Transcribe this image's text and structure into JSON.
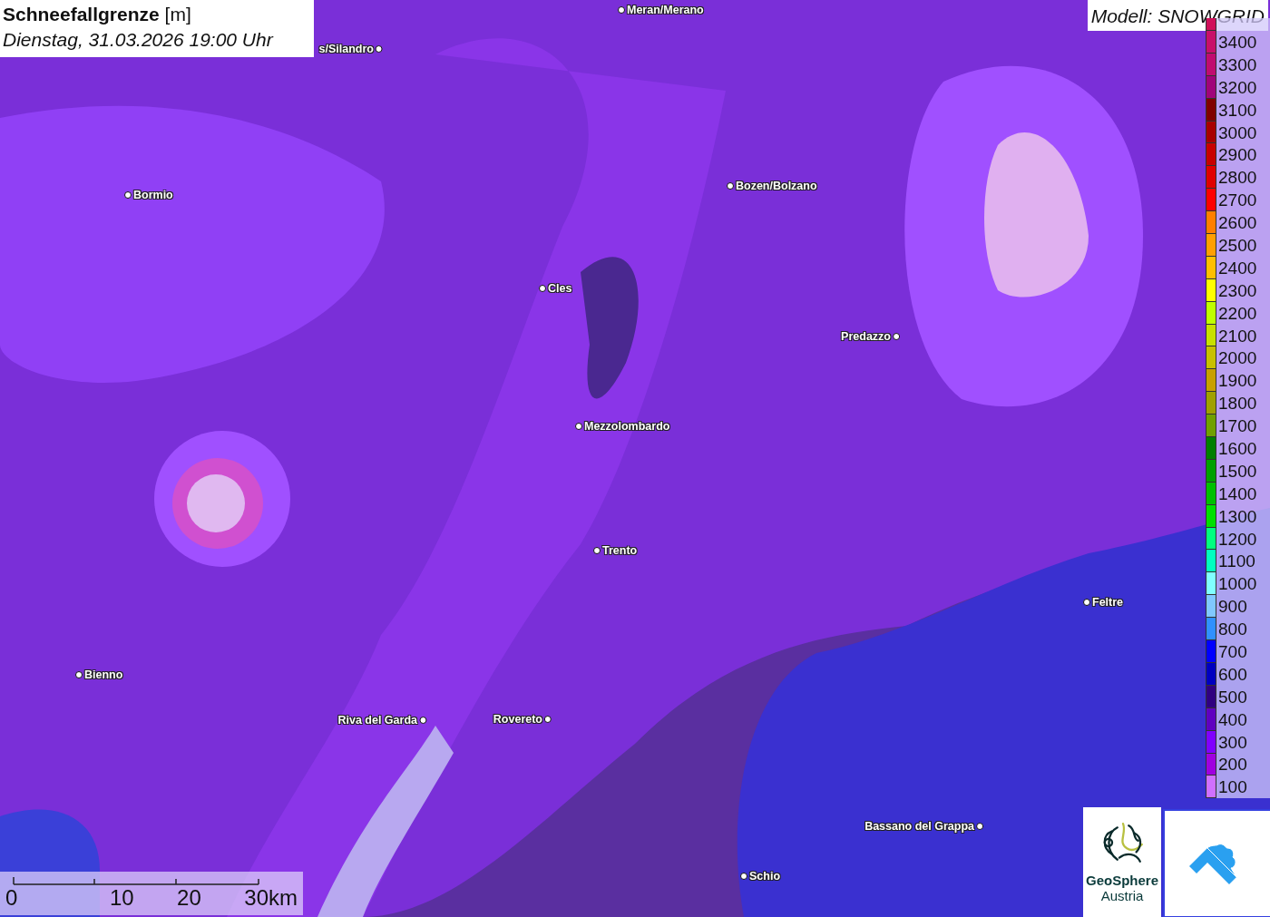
{
  "title": {
    "parameter": "Schneefallgrenze",
    "unit": "[m]",
    "datetime": "Dienstag, 31.03.2026 19:00 Uhr"
  },
  "model": "Modell: SNOWGRID",
  "places": [
    {
      "name": "Meran/Merano"
    },
    {
      "name": "s/Silandro"
    },
    {
      "name": "Bormio"
    },
    {
      "name": "Bozen/Bolzano"
    },
    {
      "name": "Cles"
    },
    {
      "name": "Predazzo"
    },
    {
      "name": "Mezzolombardo"
    },
    {
      "name": "Trento"
    },
    {
      "name": "Feltre"
    },
    {
      "name": "Bienno"
    },
    {
      "name": "Riva del Garda"
    },
    {
      "name": "Rovereto"
    },
    {
      "name": "Bassano del Grappa"
    },
    {
      "name": "Schio"
    }
  ],
  "legend": [
    {
      "label": "3400",
      "color": "#c8106a"
    },
    {
      "label": "3300",
      "color": "#c00c70"
    },
    {
      "label": "3200",
      "color": "#a0047a"
    },
    {
      "label": "3100",
      "color": "#800000"
    },
    {
      "label": "3000",
      "color": "#a80000"
    },
    {
      "label": "2900",
      "color": "#c80000"
    },
    {
      "label": "2800",
      "color": "#e00000"
    },
    {
      "label": "2700",
      "color": "#ff0000"
    },
    {
      "label": "2600",
      "color": "#ff7f00"
    },
    {
      "label": "2500",
      "color": "#ff9f00"
    },
    {
      "label": "2400",
      "color": "#ffbf00"
    },
    {
      "label": "2300",
      "color": "#ffff00"
    },
    {
      "label": "2200",
      "color": "#bfff00"
    },
    {
      "label": "2100",
      "color": "#c8e000"
    },
    {
      "label": "2000",
      "color": "#c8c000"
    },
    {
      "label": "1900",
      "color": "#c8a000"
    },
    {
      "label": "1800",
      "color": "#a0a000"
    },
    {
      "label": "1700",
      "color": "#70a000"
    },
    {
      "label": "1600",
      "color": "#007f00"
    },
    {
      "label": "1500",
      "color": "#00a000"
    },
    {
      "label": "1400",
      "color": "#00c000"
    },
    {
      "label": "1300",
      "color": "#00e000"
    },
    {
      "label": "1200",
      "color": "#00ff80"
    },
    {
      "label": "1100",
      "color": "#00ffc0"
    },
    {
      "label": "1000",
      "color": "#80ffff"
    },
    {
      "label": "900",
      "color": "#80c8ff"
    },
    {
      "label": "800",
      "color": "#3090ff"
    },
    {
      "label": "700",
      "color": "#0000ff"
    },
    {
      "label": "600",
      "color": "#0000c0"
    },
    {
      "label": "500",
      "color": "#300080"
    },
    {
      "label": "400",
      "color": "#6000c0"
    },
    {
      "label": "300",
      "color": "#8000ff"
    },
    {
      "label": "200",
      "color": "#a000e0"
    },
    {
      "label": "100",
      "color": "#d070ff"
    }
  ],
  "scale": {
    "ticks": [
      "0",
      "10",
      "20",
      "30km"
    ]
  },
  "logo": {
    "name": "GeoSphere",
    "subtitle": "Austria"
  }
}
